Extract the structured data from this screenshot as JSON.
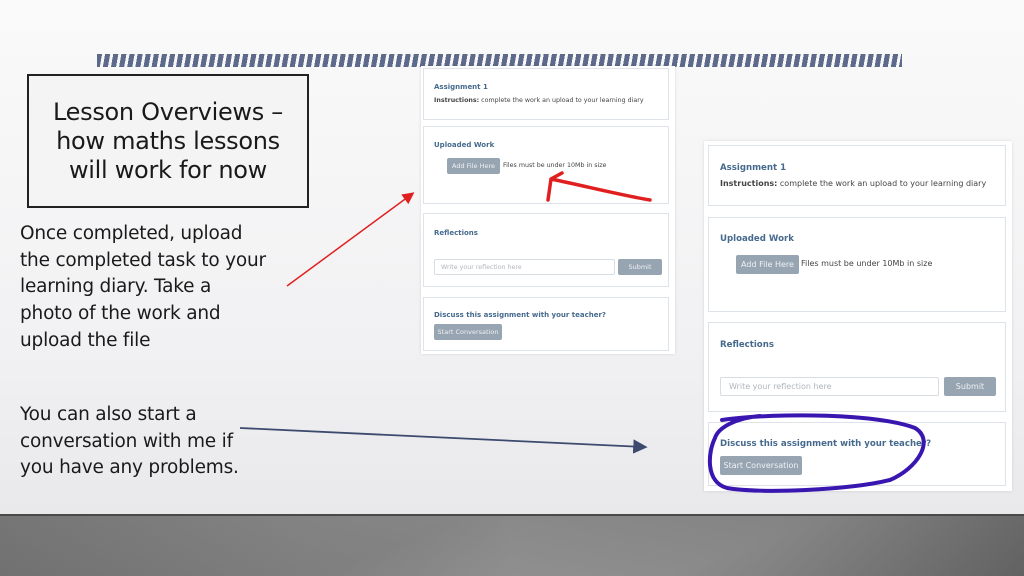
{
  "slide": {
    "title": "Lesson Overviews –\nhow maths lessons\nwill work for now",
    "paragraph_upload": "Once completed, upload\nthe completed task to your\nlearning diary.  Take a\nphoto of the work and\nupload the file",
    "paragraph_conversation": "You can also start a\nconversation with me if\nyou have any problems."
  },
  "assignment_screenshot": {
    "assignment_title": "Assignment 1",
    "instructions_label": "Instructions:",
    "instructions_text": " complete the work an upload to your learning diary",
    "uploaded_work_heading": "Uploaded Work",
    "add_file_button": "Add File Here",
    "file_size_note": "Files must be under 10Mb in size",
    "reflections_heading": "Reflections",
    "reflection_placeholder": "Write your reflection here",
    "submit_button": "Submit",
    "discuss_heading": "Discuss this assignment with your teacher?",
    "start_conversation_button": "Start Conversation"
  },
  "annotations": {
    "red_arrow_color": "#e02020",
    "navy_arrow_color": "#3c4a6e",
    "highlight_circle_color": "#3a16b0"
  },
  "colors": {
    "stripe": "#5d6a8c",
    "heading_blue": "#466a8e",
    "button_gray": "#97a4b1"
  }
}
